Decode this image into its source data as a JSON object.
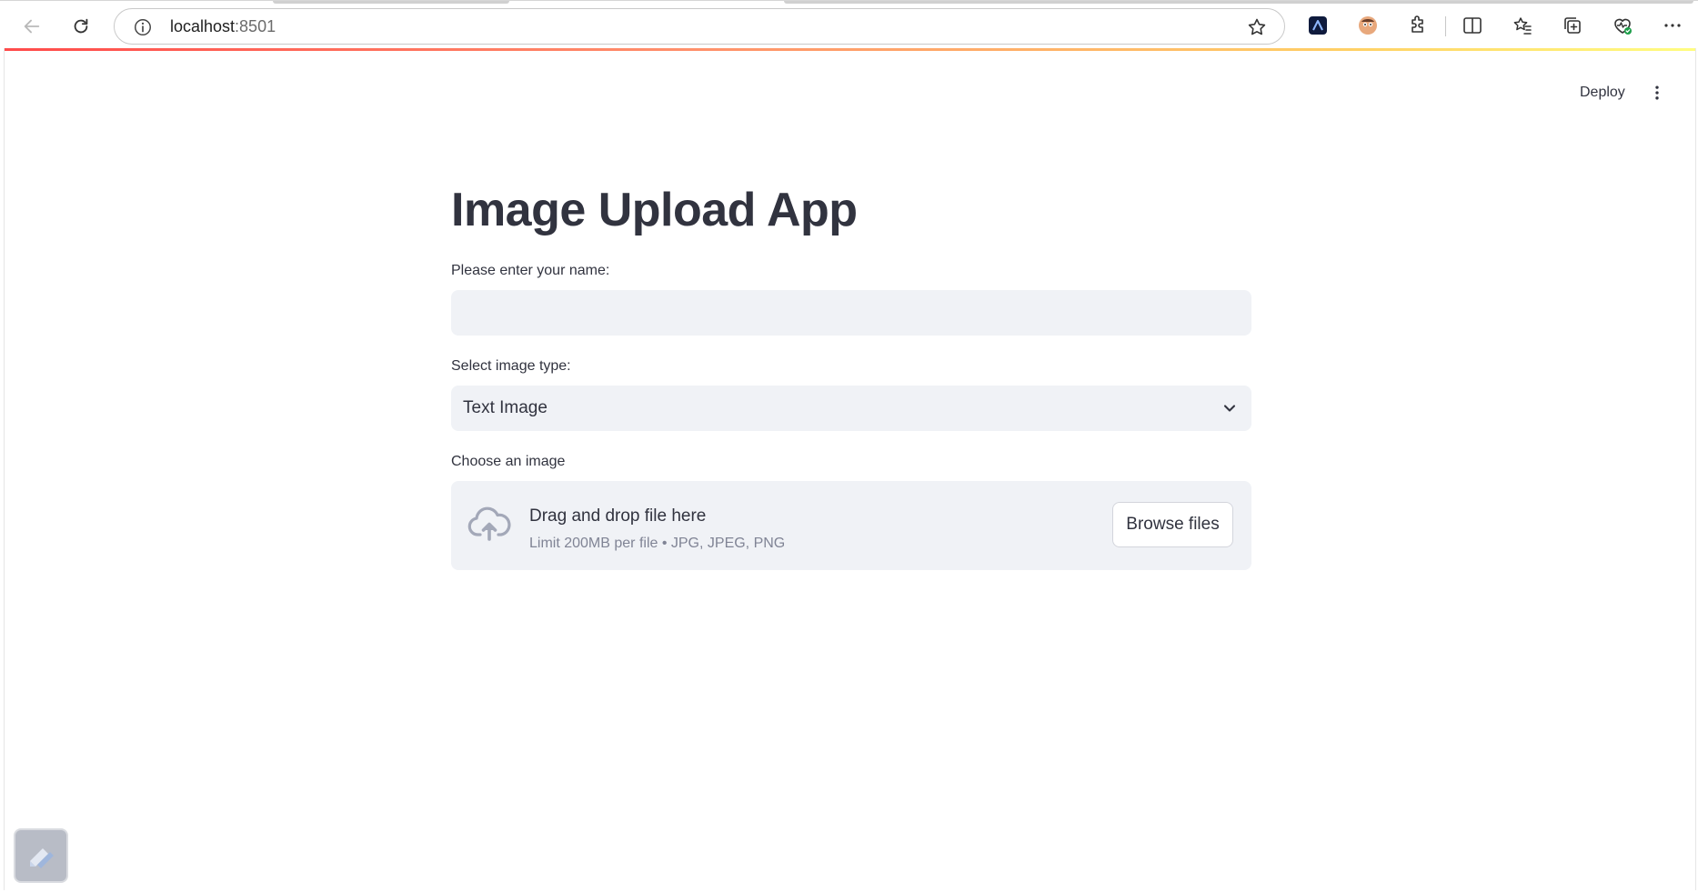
{
  "browser": {
    "url_host": "localhost",
    "url_port": ":8501",
    "icons": {
      "back": "back-arrow-icon",
      "reload": "reload-icon",
      "info": "info-icon",
      "star": "star-icon",
      "extensions": [
        "azure-extension-icon",
        "avatar-extension-icon",
        "puzzle-extensions-icon",
        "split-screen-icon",
        "favorites-icon",
        "collections-icon",
        "browser-essentials-icon",
        "more-icon"
      ]
    }
  },
  "header": {
    "deploy_label": "Deploy",
    "menu_icon": "vertical-ellipsis-icon"
  },
  "main": {
    "title": "Image Upload App",
    "name_field": {
      "label": "Please enter your name:",
      "value": ""
    },
    "image_type": {
      "label": "Select image type:",
      "selected": "Text Image"
    },
    "uploader": {
      "label": "Choose an image",
      "drop_text": "Drag and drop file here",
      "limit_text": "Limit 200MB per file • JPG, JPEG, PNG",
      "browse_label": "Browse files"
    }
  },
  "colors": {
    "accent_gradient_start": "#ff4b4b",
    "accent_gradient_end": "#fffd80",
    "input_bg": "#f0f2f6",
    "text": "#31333f",
    "muted_text": "#808495"
  }
}
